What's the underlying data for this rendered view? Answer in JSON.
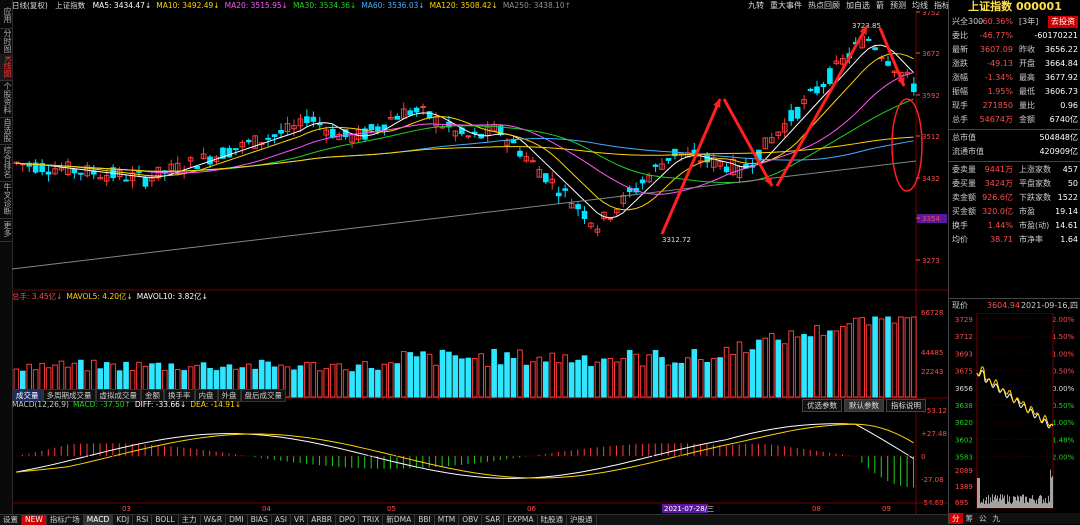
{
  "left_tabs": [
    "应用",
    "分时图",
    "K线图",
    "个股资料",
    "自选股",
    "综合排名",
    "牛叉诊断",
    "更多"
  ],
  "header": {
    "period": "日线(复权)",
    "name": "上证指数",
    "ma": [
      {
        "label": "MA5: 3434.47↓",
        "color": "#ffffff"
      },
      {
        "label": "MA10: 3492.49↓",
        "color": "#ffd400"
      },
      {
        "label": "MA20: 3515.95↓",
        "color": "#ff55ff"
      },
      {
        "label": "MA30: 3534.36↓",
        "color": "#20d020"
      },
      {
        "label": "MA60: 3536.03↓",
        "color": "#40b0ff"
      },
      {
        "label": "MA120: 3508.42↓",
        "color": "#ffd400"
      },
      {
        "label": "MA250: 3438.10↑",
        "color": "#909090"
      }
    ]
  },
  "top_menu": [
    "九转",
    "重大事件",
    "热点回顾",
    "加自选",
    "箭",
    "预测",
    "均线",
    "指标"
  ],
  "price_axis": [
    "3752",
    "3672",
    "3592",
    "3512",
    "3432",
    "3354",
    "3273"
  ],
  "price_axis_current": "3354",
  "annotations": {
    "high": "3723.85",
    "low": "3312.72"
  },
  "volume": {
    "header": [
      {
        "label": "总手: 3.45亿↓",
        "color": "#ff4b4b"
      },
      {
        "label": "MAVOL5: 4.20亿↓",
        "color": "#ffd400"
      },
      {
        "label": "MAVOL10: 3.82亿↓",
        "color": "#ffffff"
      }
    ],
    "axis": [
      "66728",
      "44485",
      "22243"
    ],
    "tabs": [
      "成交量",
      "多周期成交量",
      "虚拟成交量",
      "金额",
      "换手率",
      "内盘",
      "外盘",
      "盘后成交量"
    ]
  },
  "macd": {
    "header": [
      {
        "label": "MACD(12,26,9)",
        "color": "#cccccc"
      },
      {
        "label": "MACD: -37.50↑",
        "color": "#20d020"
      },
      {
        "label": "DIFF: -33.66↓",
        "color": "#ffffff"
      },
      {
        "label": "DEA: -14.91↓",
        "color": "#ffd400"
      }
    ],
    "buttons": [
      "优选参数",
      "默认参数",
      "指标说明"
    ],
    "axis": [
      "+53.12",
      "+27.48",
      "0",
      "-27.08",
      "-54.69"
    ]
  },
  "date_axis": [
    "03",
    "04",
    "05",
    "06",
    "07",
    "08",
    "09"
  ],
  "date_highlight": "2021-07-28/三",
  "bottom_tabs": [
    "设置",
    "NEW",
    "指标广场",
    "MACD",
    "KDJ",
    "RSI",
    "BOLL",
    "主力",
    "W&R",
    "DMI",
    "BIAS",
    "ASI",
    "VR",
    "ARBR",
    "DPO",
    "TRIX",
    "新DMA",
    "BBI",
    "MTM",
    "OBV",
    "SAR",
    "EXPMA",
    "陆股通",
    "沪股通"
  ],
  "right_panel": {
    "title": "上证指数 000001",
    "rows1": [
      {
        "l": "兴全300",
        "v": "+60.36%",
        "l2": "[3年]",
        "v2": "去投资"
      },
      {
        "l": "委比",
        "v": "-46.77%",
        "l2": "",
        "v2": "-60170221"
      },
      {
        "l": "最新",
        "v": "3607.09",
        "l2": "昨收",
        "v2": "3656.22"
      },
      {
        "l": "涨跌",
        "v": "-49.13",
        "l2": "开盘",
        "v2": "3664.84"
      },
      {
        "l": "涨幅",
        "v": "-1.34%",
        "l2": "最高",
        "v2": "3677.92"
      },
      {
        "l": "振幅",
        "v": "1.95%",
        "l2": "最低",
        "v2": "3606.73"
      },
      {
        "l": "现手",
        "v": "271850",
        "l2": "量比",
        "v2": "0.96"
      },
      {
        "l": "总手",
        "v": "54674万",
        "l2": "金额",
        "v2": "6740亿"
      }
    ],
    "rows2": [
      {
        "l": "总市值",
        "v2": "504848亿"
      },
      {
        "l": "流通市值",
        "v2": "420909亿"
      }
    ],
    "rows3": [
      {
        "l": "委卖量",
        "v": "9441万",
        "l2": "上涨家数",
        "v2": "457"
      },
      {
        "l": "委买量",
        "v": "3424万",
        "l2": "平盘家数",
        "v2": "50"
      },
      {
        "l": "卖金额",
        "v": "926.6亿",
        "l2": "下跌家数",
        "v2": "1522"
      },
      {
        "l": "买金额",
        "v": "320.0亿",
        "l2": "市盈",
        "v2": "19.14"
      },
      {
        "l": "换手",
        "v": "1.44%",
        "l2": "市盈(动)",
        "v2": "14.61"
      },
      {
        "l": "均价",
        "v": "38.71",
        "l2": "市净率",
        "v2": "1.64"
      }
    ],
    "mini": {
      "label": "现价",
      "price": "3604.94",
      "date": "2021-09-16,四",
      "left_axis": [
        "3729",
        "3712",
        "3693",
        "3675",
        "3656",
        "3638",
        "3620",
        "3602",
        "3583"
      ],
      "right_axis": [
        "2.00%",
        "1.50%",
        "1.00%",
        "0.50%",
        "0.00%",
        "0.50%",
        "1.00%",
        "1.48%",
        "2.00%"
      ],
      "vol_axis": [
        "2089",
        "1389",
        "695"
      ]
    },
    "tabs": [
      "分",
      "筹",
      "公",
      "九"
    ]
  }
}
